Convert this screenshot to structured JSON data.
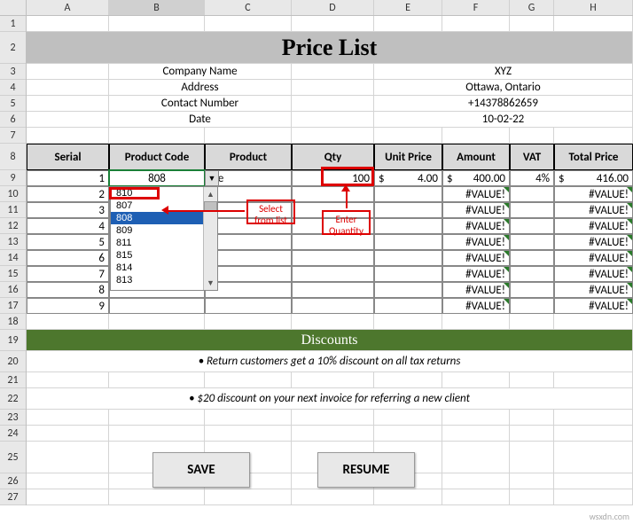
{
  "columns": [
    "A",
    "B",
    "C",
    "D",
    "E",
    "F",
    "G",
    "H"
  ],
  "active_col": "B",
  "rows": [
    "1",
    "2",
    "3",
    "4",
    "5",
    "6",
    "7",
    "8",
    "9",
    "10",
    "11",
    "12",
    "13",
    "14",
    "15",
    "16",
    "17",
    "18",
    "19",
    "20",
    "21",
    "22",
    "23",
    "24",
    "25",
    "26",
    "27"
  ],
  "title": "Price List",
  "info": {
    "labels": [
      "Company Name",
      "Address",
      "Contact Number",
      "Date"
    ],
    "values": [
      "XYZ",
      "Ottawa, Ontario",
      "+14378862659",
      "10-02-22"
    ]
  },
  "headers": [
    "Serial",
    "Product Code",
    "Product",
    "Qty",
    "Unit Price",
    "Amount",
    "VAT",
    "Total Price"
  ],
  "chart_data": {
    "type": "table",
    "columns": [
      "Serial",
      "Product Code",
      "Product",
      "Qty",
      "Unit Price",
      "Amount",
      "VAT",
      "Total Price"
    ],
    "rows": [
      {
        "serial": 1,
        "code": "808",
        "product": "ple",
        "qty": 100,
        "unit_price_prefix": "$",
        "unit_price": 4.0,
        "amount_prefix": "$",
        "amount": 400.0,
        "vat": "4%",
        "total_prefix": "$",
        "total": 416.0
      },
      {
        "serial": 2,
        "code": "",
        "product": "",
        "qty": "",
        "unit_price": "",
        "amount": "#VALUE!",
        "vat": "",
        "total": "#VALUE!"
      },
      {
        "serial": 3,
        "code": "",
        "product": "",
        "qty": "",
        "unit_price": "",
        "amount": "#VALUE!",
        "vat": "",
        "total": "#VALUE!"
      },
      {
        "serial": 4,
        "code": "",
        "product": "",
        "qty": "",
        "unit_price": "",
        "amount": "#VALUE!",
        "vat": "",
        "total": "#VALUE!"
      },
      {
        "serial": 5,
        "code": "",
        "product": "",
        "qty": "",
        "unit_price": "",
        "amount": "#VALUE!",
        "vat": "",
        "total": "#VALUE!"
      },
      {
        "serial": 6,
        "code": "",
        "product": "",
        "qty": "",
        "unit_price": "",
        "amount": "#VALUE!",
        "vat": "",
        "total": "#VALUE!"
      },
      {
        "serial": 7,
        "code": "",
        "product": "",
        "qty": "",
        "unit_price": "",
        "amount": "#VALUE!",
        "vat": "",
        "total": "#VALUE!"
      },
      {
        "serial": 8,
        "code": "",
        "product": "",
        "qty": "",
        "unit_price": "",
        "amount": "#VALUE!",
        "vat": "",
        "total": "#VALUE!"
      },
      {
        "serial": 9,
        "code": "",
        "product": "",
        "qty": "",
        "unit_price": "",
        "amount": "#VALUE!",
        "vat": "",
        "total": "#VALUE!"
      }
    ]
  },
  "dropdown": {
    "options": [
      "810",
      "807",
      "808",
      "809",
      "811",
      "815",
      "814",
      "813"
    ],
    "selected": "808"
  },
  "callouts": {
    "select_from_list": "Select from list",
    "enter_quantity": "Enter Quantity"
  },
  "discounts": {
    "title": "Discounts",
    "line1": "• Return customers get a 10% discount on all tax returns",
    "line2": "• $20 discount on your next invoice for referring a new client"
  },
  "buttons": {
    "save": "SAVE",
    "resume": "RESUME"
  },
  "watermark": "wsxdn.com"
}
